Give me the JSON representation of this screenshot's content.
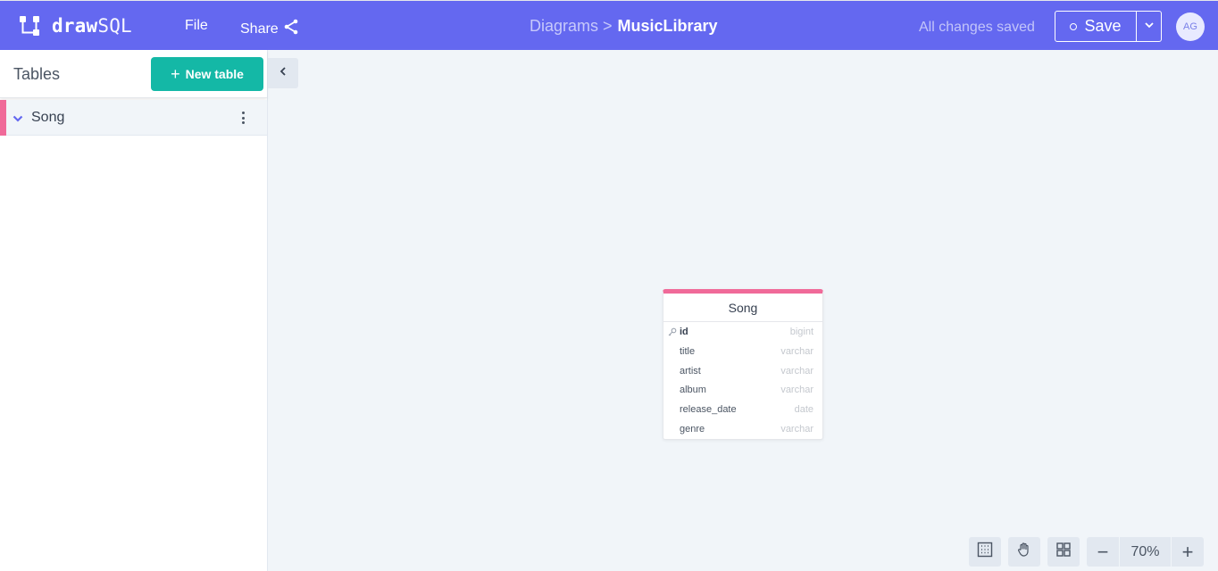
{
  "app": {
    "logo_bold": "draw",
    "logo_light": "SQL"
  },
  "topbar": {
    "file_label": "File",
    "share_label": "Share",
    "breadcrumb_root": "Diagrams >",
    "breadcrumb_current": "MusicLibrary",
    "status": "All changes saved",
    "save_label": "Save",
    "avatar_initials": "AG"
  },
  "sidebar": {
    "title": "Tables",
    "new_table_label": "New table",
    "tables": [
      {
        "name": "Song",
        "color": "#f06a99"
      }
    ]
  },
  "canvas": {
    "table": {
      "name": "Song",
      "columns": [
        {
          "name": "id",
          "type": "bigint",
          "primary_key": true
        },
        {
          "name": "title",
          "type": "varchar"
        },
        {
          "name": "artist",
          "type": "varchar"
        },
        {
          "name": "album",
          "type": "varchar"
        },
        {
          "name": "release_date",
          "type": "date"
        },
        {
          "name": "genre",
          "type": "varchar"
        }
      ]
    }
  },
  "toolbar": {
    "zoom": "70%",
    "zoom_out_symbol": "−",
    "zoom_in_symbol": "+"
  },
  "colors": {
    "brand": "#6468f0",
    "accent": "#14b8a6",
    "table_color": "#f06a99"
  },
  "icons": [
    "logo-icon",
    "share-icon",
    "chevron-down-icon",
    "kebab-icon",
    "chevron-left-icon",
    "key-icon",
    "fit-view-icon",
    "hand-icon",
    "grid-icon"
  ]
}
